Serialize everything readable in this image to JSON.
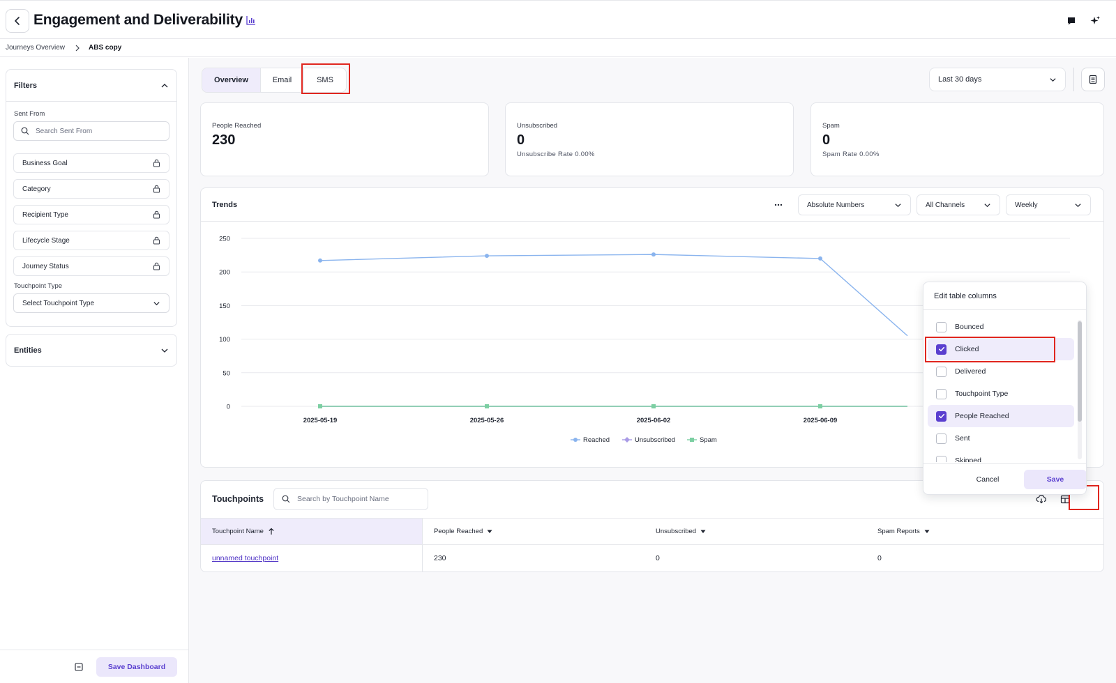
{
  "header": {
    "title": "Engagement and Deliverability",
    "title_icon": "bar-chart-icon",
    "actions": [
      "comment-icon",
      "sparkle-icon"
    ]
  },
  "breadcrumb": [
    "Journeys Overview",
    "ABS copy"
  ],
  "sidebar": {
    "filters_title": "Filters",
    "sent_from_label": "Sent From",
    "sent_from_placeholder": "Search Sent From",
    "locked_filters": [
      "Business Goal",
      "Category",
      "Recipient Type",
      "Lifecycle Stage",
      "Journey Status"
    ],
    "touchpoint_type_label": "Touchpoint Type",
    "touchpoint_type_placeholder": "Select Touchpoint Type",
    "entities_title": "Entities",
    "save_dashboard_label": "Save Dashboard"
  },
  "tabs": [
    "Overview",
    "Email",
    "SMS"
  ],
  "date_range": "Last 30 days",
  "stats": [
    {
      "label": "People Reached",
      "value": "230",
      "sub": ""
    },
    {
      "label": "Unsubscribed",
      "value": "0",
      "sub": "Unsubscribe Rate 0.00%"
    },
    {
      "label": "Spam",
      "value": "0",
      "sub": "Spam Rate 0.00%"
    }
  ],
  "trends": {
    "title": "Trends",
    "metric_select": "Absolute Numbers",
    "channel_select": "All Channels",
    "interval_select": "Weekly"
  },
  "chart_data": {
    "type": "line",
    "x": [
      "2025-05-19",
      "2025-05-26",
      "2025-06-02",
      "2025-06-09"
    ],
    "y_ticks": [
      0,
      50,
      100,
      150,
      200,
      250
    ],
    "ylim": [
      0,
      250
    ],
    "grid": true,
    "legend": "bottom",
    "series": [
      {
        "name": "Reached",
        "values": [
          217,
          224,
          226,
          220
        ],
        "color": "#8ab4ee"
      },
      {
        "name": "Unsubscribed",
        "values": [
          0,
          0,
          0,
          0
        ],
        "color": "#a99be6"
      },
      {
        "name": "Spam",
        "values": [
          0,
          0,
          0,
          0
        ],
        "color": "#7ccfa2"
      }
    ]
  },
  "touchpoints": {
    "title": "Touchpoints",
    "search_placeholder": "Search by Touchpoint Name",
    "columns": [
      "Touchpoint Name",
      "People Reached",
      "Unsubscribed",
      "Spam Reports"
    ],
    "rows": [
      {
        "name": "unnamed touchpoint",
        "reached": "230",
        "unsubscribed": "0",
        "spam": "0"
      }
    ]
  },
  "edit_columns": {
    "title": "Edit table columns",
    "items": [
      {
        "label": "Bounced",
        "checked": false
      },
      {
        "label": "Clicked",
        "checked": true
      },
      {
        "label": "Delivered",
        "checked": false
      },
      {
        "label": "Touchpoint Type",
        "checked": false
      },
      {
        "label": "People Reached",
        "checked": true
      },
      {
        "label": "Sent",
        "checked": false
      },
      {
        "label": "Skipped",
        "checked": false
      }
    ],
    "cancel_label": "Cancel",
    "save_label": "Save"
  }
}
